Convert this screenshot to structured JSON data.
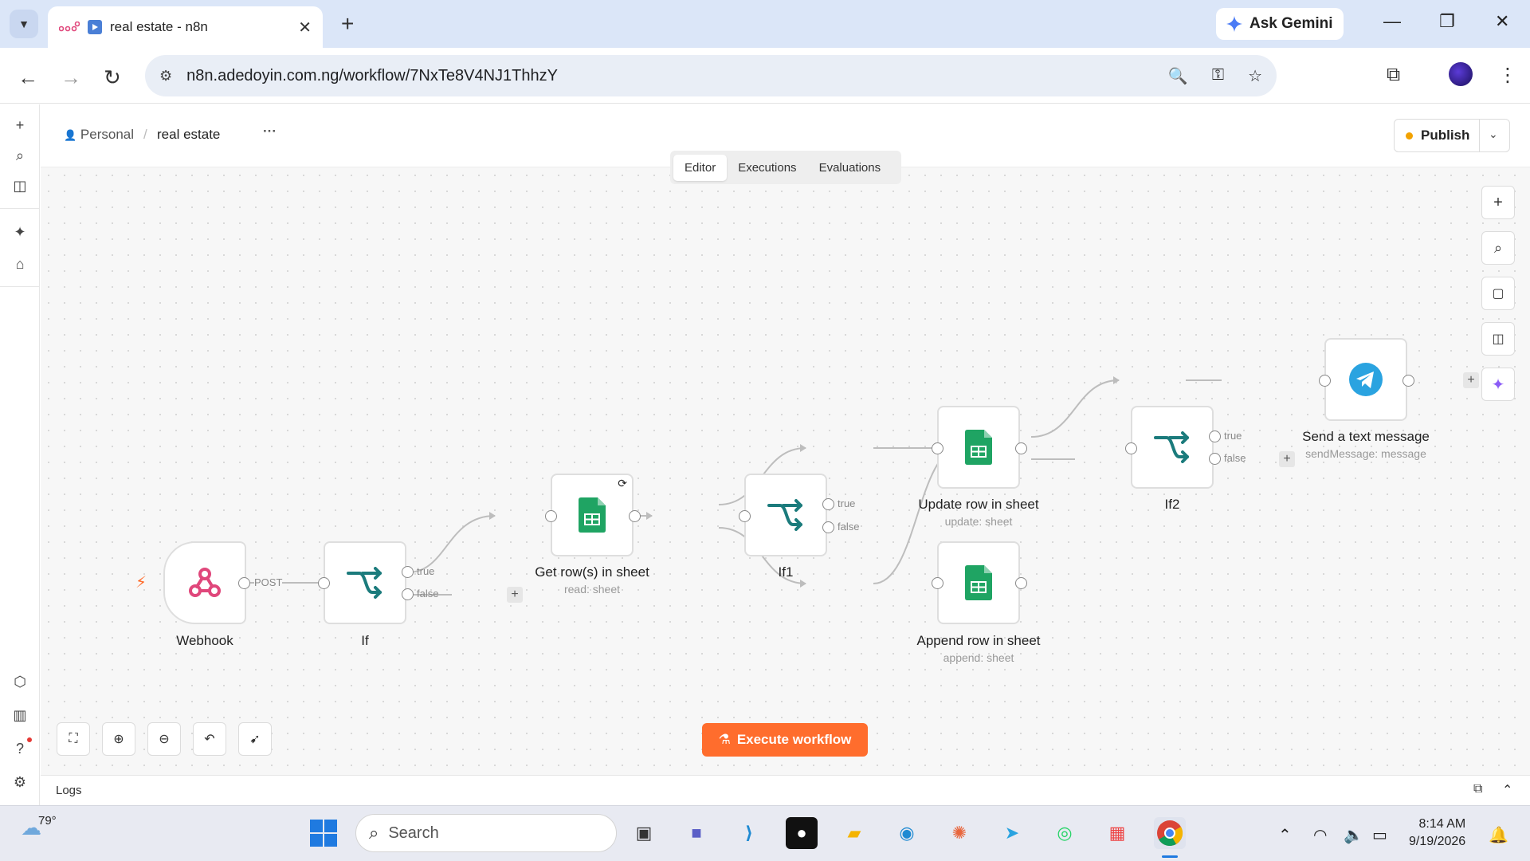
{
  "browser": {
    "tab_title": "real estate - n8n",
    "url": "n8n.adedoyin.com.ng/workflow/7NxTe8V4NJ1ThhzY",
    "gemini_label": "Ask Gemini"
  },
  "header": {
    "project": "Personal",
    "workflow": "real estate",
    "more": "···",
    "publish_label": "Publish",
    "modes": [
      "Editor",
      "Executions",
      "Evaluations"
    ],
    "active_mode": "Editor"
  },
  "nodes": {
    "webhook": {
      "name": "Webhook",
      "port": "POST"
    },
    "if": {
      "name": "If",
      "true": "true",
      "false": "false"
    },
    "get_rows": {
      "name": "Get row(s) in sheet",
      "sub": "read: sheet"
    },
    "if1": {
      "name": "If1",
      "true": "true",
      "false": "false"
    },
    "update_row": {
      "name": "Update row in sheet",
      "sub": "update: sheet"
    },
    "append_row": {
      "name": "Append row in sheet",
      "sub": "append: sheet"
    },
    "if2": {
      "name": "If2",
      "true": "true",
      "false": "false"
    },
    "telegram": {
      "name": "Send a text message",
      "sub": "sendMessage: message"
    }
  },
  "execute_label": "Execute workflow",
  "logs_label": "Logs",
  "taskbar": {
    "temperature": "79°",
    "search_placeholder": "Search",
    "time": "8:14 AM",
    "date": "9/19/2026"
  },
  "colors": {
    "accent": "#ff6d2d",
    "sheets_green": "#1fa463",
    "if_teal": "#1b7b7c",
    "webhook_pink": "#e0477b",
    "telegram_blue": "#2aa3e0"
  }
}
